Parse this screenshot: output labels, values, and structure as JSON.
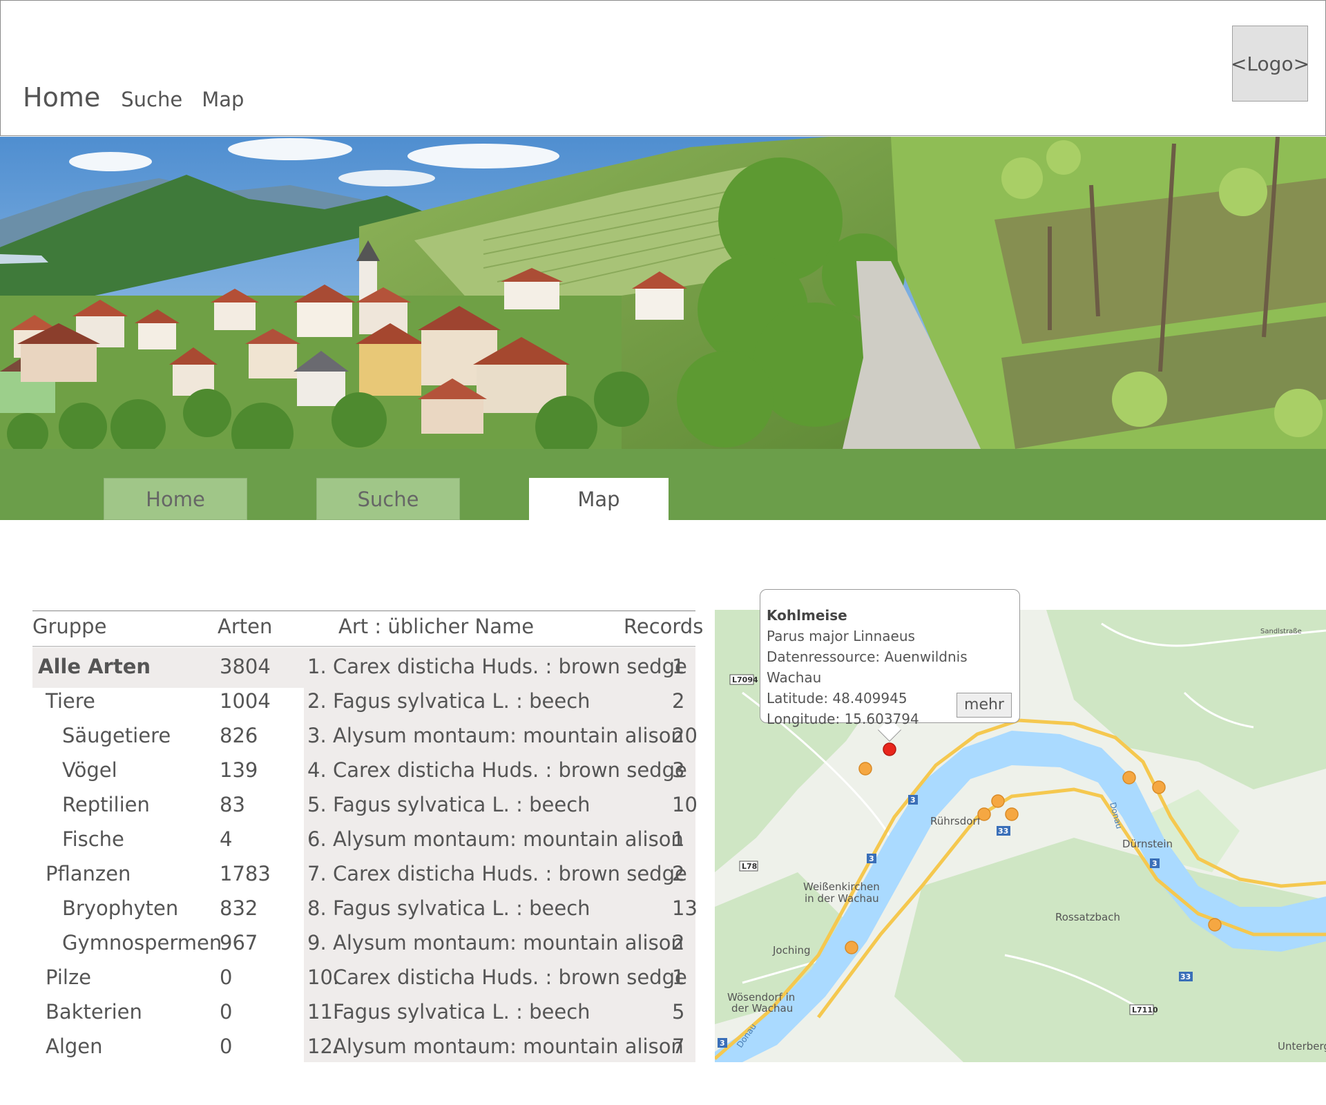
{
  "header": {
    "nav": {
      "home": "Home",
      "suche": "Suche",
      "map": "Map"
    },
    "logo": "<Logo>"
  },
  "tabs": [
    {
      "label": "Home",
      "active": false
    },
    {
      "label": "Suche",
      "active": false
    },
    {
      "label": "Map",
      "active": true
    }
  ],
  "table": {
    "headers": {
      "gruppe": "Gruppe",
      "arten": "Arten",
      "art_name": "Art : üblicher Name",
      "records": "Records"
    },
    "groups": [
      {
        "name": "Alle Arten",
        "count": "3804",
        "level": 0
      },
      {
        "name": "Tiere",
        "count": "1004",
        "level": 1
      },
      {
        "name": "Säugetiere",
        "count": "826",
        "level": 2
      },
      {
        "name": "Vögel",
        "count": "139",
        "level": 2
      },
      {
        "name": "Reptilien",
        "count": "83",
        "level": 2
      },
      {
        "name": "Fische",
        "count": "4",
        "level": 2
      },
      {
        "name": "Pflanzen",
        "count": "1783",
        "level": 1
      },
      {
        "name": "Bryophyten",
        "count": "832",
        "level": 2
      },
      {
        "name": "Gymnospermen",
        "count": "967",
        "level": 2
      },
      {
        "name": "Pilze",
        "count": "0",
        "level": 1
      },
      {
        "name": "Bakterien",
        "count": "0",
        "level": 1
      },
      {
        "name": "Algen",
        "count": "0",
        "level": 1
      }
    ],
    "species": [
      {
        "num": "1.",
        "name": "Carex disticha Huds. : brown sedge",
        "records": "1"
      },
      {
        "num": "2.",
        "name": "Fagus sylvatica L. : beech",
        "records": "2"
      },
      {
        "num": "3.",
        "name": "Alysum montaum: mountain alison",
        "records": "20"
      },
      {
        "num": "4.",
        "name": "Carex disticha Huds. : brown sedge",
        "records": "3"
      },
      {
        "num": "5.",
        "name": "Fagus sylvatica L. : beech",
        "records": "10"
      },
      {
        "num": "6.",
        "name": "Alysum montaum: mountain alison",
        "records": "1"
      },
      {
        "num": "7.",
        "name": "Carex disticha Huds. : brown sedge",
        "records": "2"
      },
      {
        "num": "8.",
        "name": "Fagus sylvatica L. : beech",
        "records": "13"
      },
      {
        "num": "9.",
        "name": "Alysum montaum: mountain alison",
        "records": "2"
      },
      {
        "num": "10.",
        "name": "Carex disticha Huds. : brown sedge",
        "records": "1"
      },
      {
        "num": "11.",
        "name": "Fagus sylvatica L. : beech",
        "records": "5"
      },
      {
        "num": "12.",
        "name": "Alysum montaum: mountain alison",
        "records": "7"
      }
    ]
  },
  "popup": {
    "title": "Kohlmeise",
    "species": "Parus major Linnaeus",
    "datenressource": "Datenressource: Auenwildnis Wachau",
    "latitude": "Latitude: 48.409945",
    "longitude": "Longitude: 15.603794",
    "more_button": "mehr"
  },
  "map": {
    "places": [
      "Rührsdorf",
      "Dürnstein",
      "Weißenkirchen",
      "in der Wachau",
      "Rossatzbach",
      "Joching",
      "Wösendorf in",
      "der Wachau",
      "Unterberg",
      "Sandlstraße",
      "Donau",
      "Donau"
    ],
    "road_labels": [
      "L7094",
      "L78",
      "L7110",
      "3",
      "3",
      "33",
      "3",
      "33",
      "3"
    ],
    "colors": {
      "water": "#aadaff",
      "land": "#e8efe4",
      "green": "#cde8c5",
      "road": "#f5c84f",
      "marker": "#f5a742",
      "selected_marker": "#e8261c"
    }
  }
}
